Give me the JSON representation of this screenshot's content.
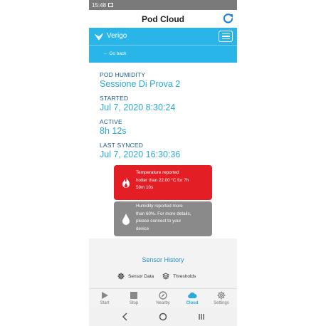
{
  "status_bar": {
    "time": "15:48"
  },
  "app_bar": {
    "title": "Pod Cloud",
    "refresh_icon": "refresh-icon"
  },
  "vendor_header": {
    "brand": "Verigo",
    "logo_icon": "verigo-bird-logo",
    "menu_icon": "hamburger-menu-icon"
  },
  "sub_bar": {
    "back_label": "Go back"
  },
  "pod": {
    "humidity_label": "POD HUMIDITY",
    "session_name": "Sessione Di Prova 2",
    "started_label": "STARTED",
    "started_value": "Jul 7, 2020 8:30:24",
    "active_label": "ACTIVE",
    "active_value": "8h 12s",
    "last_synced_label": "LAST SYNCED",
    "last_synced_value": "Jul 7, 2020 16:30:36"
  },
  "alerts": [
    {
      "icon": "fire-icon",
      "color": "#e31e24",
      "lines": [
        "Temperature reported",
        "hotter than 22.00 °C for 7h",
        "59m 10s"
      ]
    },
    {
      "icon": "water-drop-icon",
      "color": "#8a8a8a",
      "lines": [
        "Humidity reported more",
        "than 60%. For more details,",
        "please connect to your",
        "device"
      ]
    }
  ],
  "sensor": {
    "history_title": "Sensor History",
    "tabs": [
      {
        "label": "Sensor Data",
        "icon": "gear-icon"
      },
      {
        "label": "Thresholds",
        "icon": "layers-icon"
      }
    ]
  },
  "bottom_nav": [
    {
      "label": "Start",
      "icon": "play-icon"
    },
    {
      "label": "Stop",
      "icon": "stop-icon"
    },
    {
      "label": "Nearby",
      "icon": "compass-icon"
    },
    {
      "label": "Cloud",
      "icon": "cloud-icon",
      "active": true
    },
    {
      "label": "Settings",
      "icon": "gear-icon"
    }
  ],
  "system_nav": {
    "back_icon": "back-chevron-icon",
    "home_icon": "home-circle-icon",
    "recents_icon": "recents-icon"
  },
  "colors": {
    "accent": "#29b5e8",
    "value_text": "#2ba9d8",
    "label_text": "#1a5a8c",
    "alert_red": "#e31e24",
    "alert_gray": "#8a8a8a"
  }
}
